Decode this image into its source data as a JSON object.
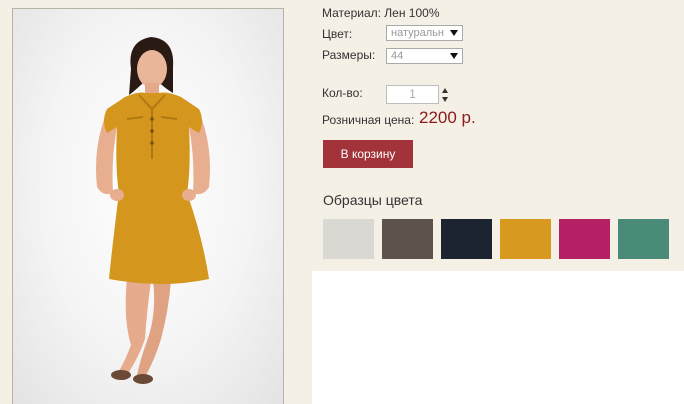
{
  "product": {
    "material": "Материал: Лен 100%",
    "color_label": "Цвет:",
    "color_value": "натуральн",
    "size_label": "Размеры:",
    "size_value": "44",
    "qty_label": "Кол-во:",
    "qty_value": "1",
    "price_label": "Розничная цена:",
    "price_value": "2200 р.",
    "cart_button": "В корзину",
    "swatches_title": "Образцы цвета"
  },
  "swatches": [
    {
      "name": "natural-gray",
      "color": "#d9d8d2"
    },
    {
      "name": "brown-gray",
      "color": "#5b534c"
    },
    {
      "name": "navy",
      "color": "#1c2432"
    },
    {
      "name": "mustard",
      "color": "#d7991f"
    },
    {
      "name": "raspberry",
      "color": "#b51f64"
    },
    {
      "name": "teal",
      "color": "#4a8a78"
    }
  ],
  "colors": {
    "background": "#f5f0e6",
    "accent": "#a3333a",
    "price": "#8b1a1a",
    "dress": "#d4961c"
  }
}
